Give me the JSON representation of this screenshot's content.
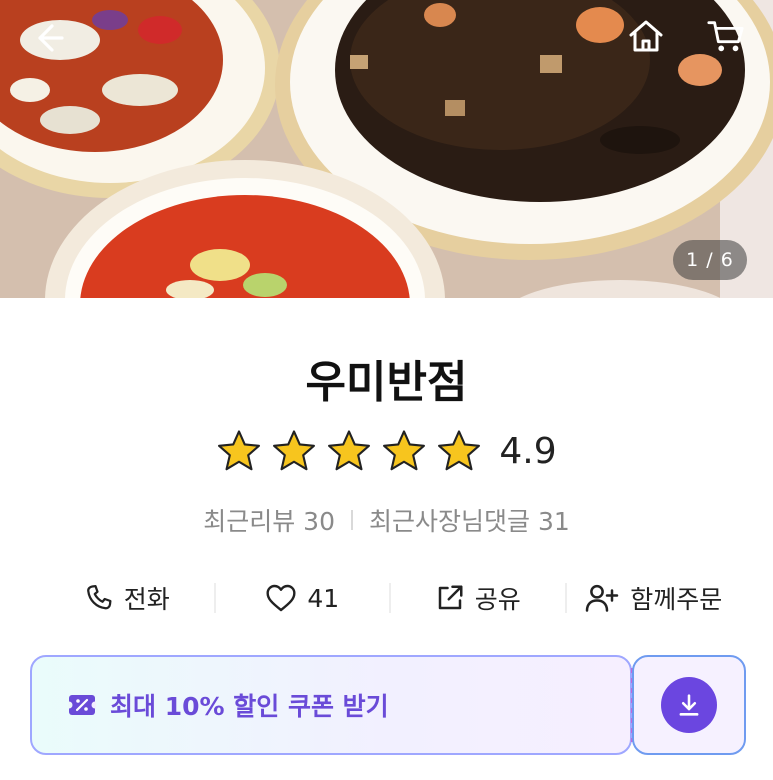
{
  "store": {
    "name": "우미반점",
    "rating": "4.9",
    "stars_filled": 5,
    "stars_total": 5
  },
  "gallery": {
    "counter": "1 / 6"
  },
  "reviews": {
    "recent_reviews": "최근리뷰 30",
    "owner_comments": "최근사장님댓글 31"
  },
  "actions": {
    "call_label": "전화",
    "like_count": "41",
    "share_label": "공유",
    "group_order_label": "함께주문"
  },
  "coupon": {
    "label": "최대 10% 할인 쿠폰 받기"
  },
  "colors": {
    "star": "#f7c51e",
    "accent_purple": "#6b46e0",
    "coupon_text": "#6a4bd8"
  },
  "icons": [
    "back-arrow-icon",
    "home-icon",
    "cart-icon",
    "star-icon",
    "phone-icon",
    "heart-icon",
    "share-icon",
    "add-user-icon",
    "coupon-icon",
    "download-icon"
  ]
}
